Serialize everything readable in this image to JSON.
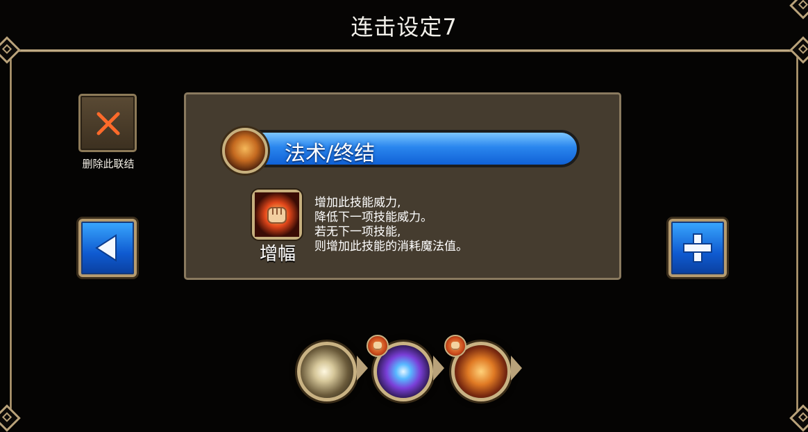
{
  "header": {
    "title": "连击设定7"
  },
  "delete": {
    "label": "删除此联结",
    "icon": "close-x-icon"
  },
  "nav": {
    "prev_icon": "left-arrow-icon",
    "add_icon": "plus-icon"
  },
  "link_type": {
    "label": "法术/终结",
    "icon": "spell-finisher-orb-icon"
  },
  "skill": {
    "name": "增幅",
    "icon": "fist-amplify-icon",
    "description": [
      "增加此技能威力,",
      "降低下一项技能威力。",
      "若无下一项技能,",
      "则增加此技能的消耗魔法值。"
    ]
  },
  "combo_chain": [
    {
      "icon": "whirlwind-skill-icon",
      "has_modifier": false
    },
    {
      "icon": "lightning-skill-icon",
      "has_modifier": true,
      "modifier_icon": "fist-amplify-icon"
    },
    {
      "icon": "fire-dome-skill-icon",
      "has_modifier": true,
      "modifier_icon": "fist-amplify-icon"
    }
  ],
  "colors": {
    "accent_blue": "#1f7ae8",
    "frame_gold": "#c7b07e",
    "panel_bg": "#453c2f"
  }
}
